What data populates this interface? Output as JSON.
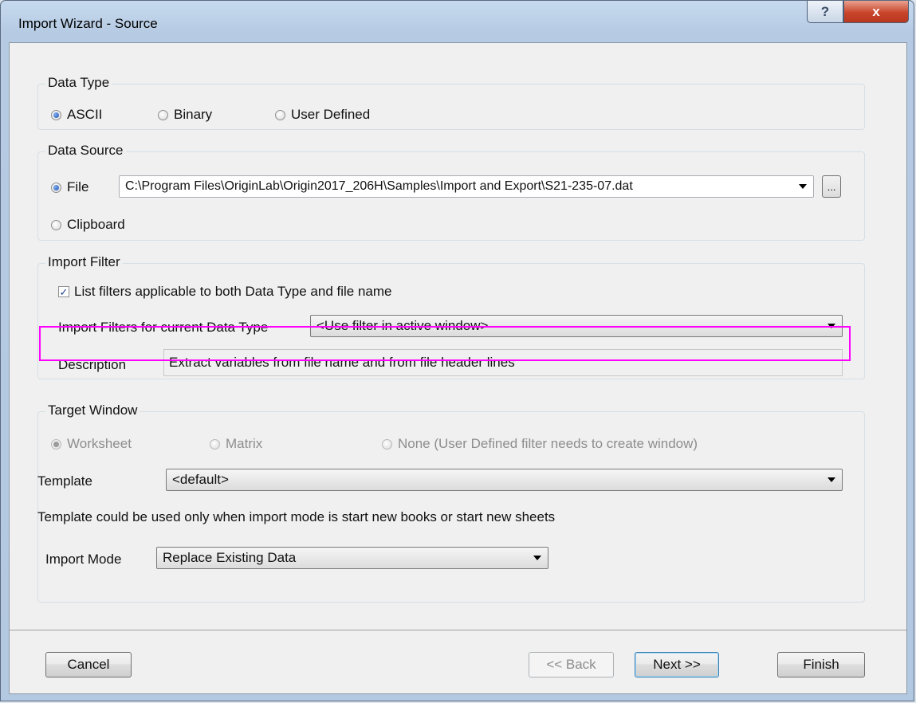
{
  "window": {
    "title": "Import Wizard - Source",
    "help_label": "?",
    "close_label": "x"
  },
  "data_type": {
    "group_label": "Data Type",
    "options": [
      "ASCII",
      "Binary",
      "User Defined"
    ],
    "selected": "ASCII"
  },
  "data_source": {
    "group_label": "Data Source",
    "file_label": "File",
    "clipboard_label": "Clipboard",
    "selected": "File",
    "file_path": "C:\\Program Files\\OriginLab\\Origin2017_206H\\Samples\\Import and Export\\S21-235-07.dat",
    "browse_label": "..."
  },
  "import_filter": {
    "group_label": "Import Filter",
    "checkbox_label": "List filters applicable to both Data Type and file name",
    "checkbox_checked": true,
    "filters_label": "Import Filters for current Data Type",
    "filters_value": "<Use filter in active window>",
    "description_label": "Description",
    "description_value": "Extract variables from file name and from file header lines"
  },
  "target_window": {
    "group_label": "Target Window",
    "options": [
      "Worksheet",
      "Matrix",
      "None (User Defined filter needs to create window)"
    ],
    "selected": "Worksheet",
    "template_label": "Template",
    "template_value": "<default>",
    "template_note": "Template could be used only when import mode is start new books or start new sheets",
    "import_mode_label": "Import Mode",
    "import_mode_value": "Replace Existing Data"
  },
  "footer": {
    "cancel_label": "Cancel",
    "back_label": "<< Back",
    "next_label": "Next >>",
    "finish_label": "Finish"
  },
  "colors": {
    "highlight": "#ff00ff",
    "close_button": "#c8452b"
  },
  "icons": [
    "radio-selected-icon",
    "radio-unselected-icon",
    "checkmark-icon",
    "dropdown-arrow-icon",
    "close-icon",
    "help-icon"
  ]
}
